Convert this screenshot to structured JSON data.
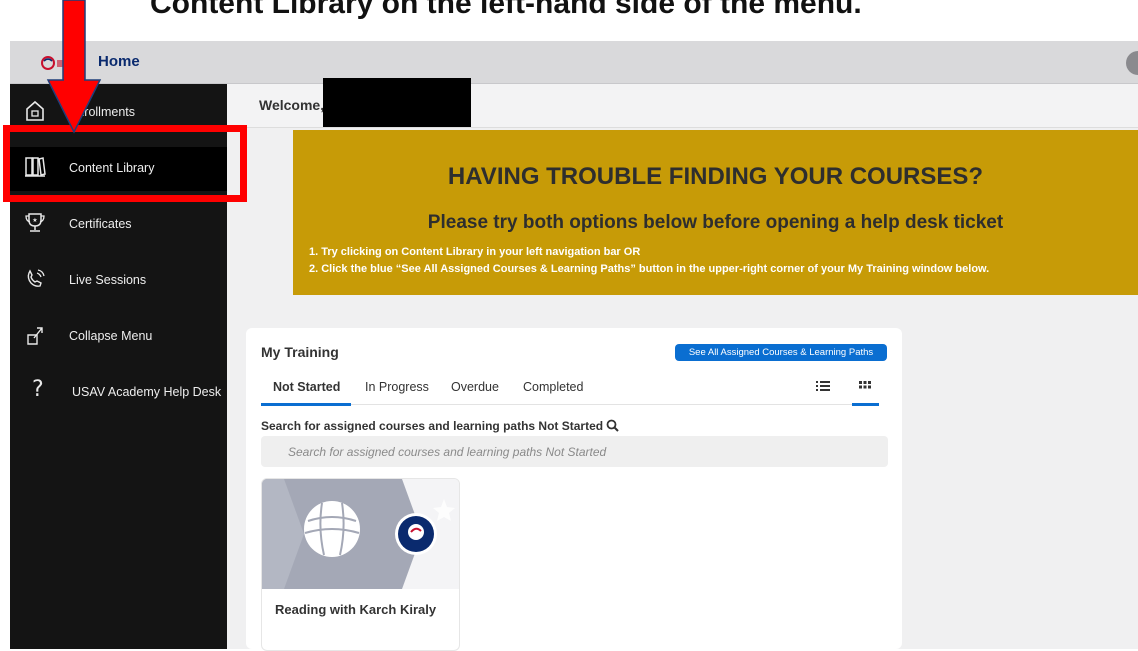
{
  "instruction": "Content Library on the left-hand side of the menu.",
  "topbar": {
    "title": "Home"
  },
  "sidebar": {
    "items": [
      {
        "label": "Enrollments",
        "icon": "home-icon"
      },
      {
        "label": "Content Library",
        "icon": "library-icon",
        "active": true
      },
      {
        "label": "Certificates",
        "icon": "trophy-icon"
      },
      {
        "label": "Live Sessions",
        "icon": "live-sessions-icon"
      },
      {
        "label": "Collapse Menu",
        "icon": "collapse-icon"
      },
      {
        "label": "USAV Academy Help Desk",
        "icon": "help-icon"
      }
    ]
  },
  "welcome": {
    "text": "Welcome,"
  },
  "banner": {
    "heading": "HAVING TROUBLE FINDING YOUR COURSES?",
    "subheading": "Please try both options below before opening a help desk ticket",
    "steps": [
      "1. Try clicking on Content Library in your left navigation bar OR",
      "2. Click the blue “See All Assigned Courses & Learning Paths” button in the upper-right corner of your My Training window below."
    ]
  },
  "training": {
    "title": "My Training",
    "see_all_label": "See All Assigned Courses & Learning Paths",
    "tabs": [
      "Not Started",
      "In Progress",
      "Overdue",
      "Completed"
    ],
    "active_tab": "Not Started",
    "search_label": "Search for assigned courses and learning paths Not Started",
    "search_placeholder": "Search for assigned courses and learning paths Not Started",
    "courses": [
      {
        "title": "Reading with Karch Kiraly"
      }
    ]
  },
  "colors": {
    "banner": "#c79b07",
    "accent": "#0a6ed1",
    "sidebar": "#141414",
    "annotation": "#ff0000"
  }
}
